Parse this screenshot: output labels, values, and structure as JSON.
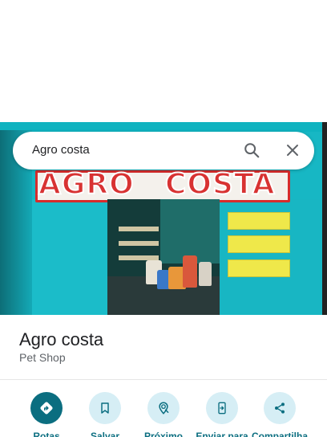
{
  "search": {
    "query": "Agro costa"
  },
  "photo": {
    "sign_left": "AGRO",
    "sign_right": "COSTA"
  },
  "place": {
    "name": "Agro costa",
    "category": "Pet Shop"
  },
  "actions": [
    {
      "label": "Rotas",
      "icon": "directions-icon"
    },
    {
      "label": "Salvar",
      "icon": "bookmark-icon"
    },
    {
      "label": "Próximo",
      "icon": "nearby-icon"
    },
    {
      "label": "Enviar para",
      "icon": "send-to-phone-icon"
    },
    {
      "label": "Compartilha",
      "icon": "share-icon"
    }
  ],
  "colors": {
    "accent": "#0b6e80",
    "action_bg": "#d6eef5",
    "text_primary": "#202124",
    "text_secondary": "#5f6368"
  }
}
